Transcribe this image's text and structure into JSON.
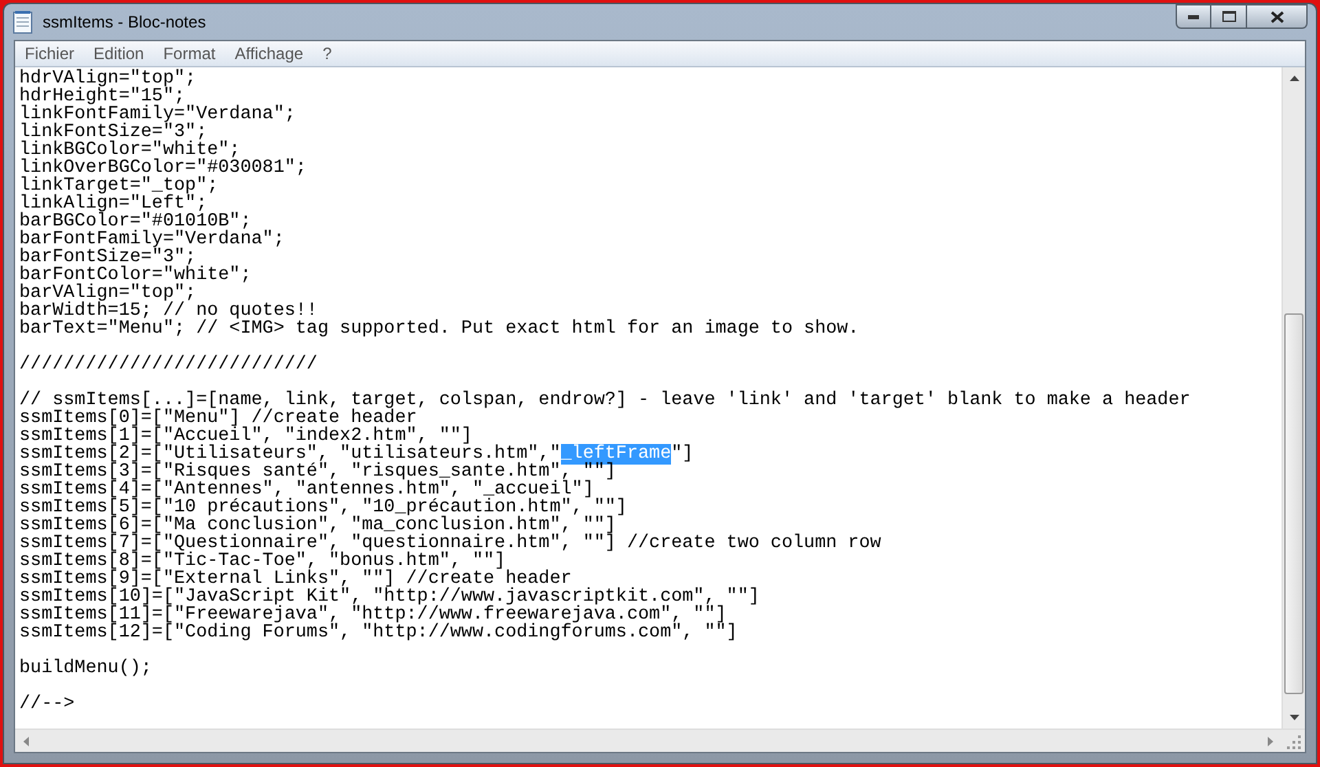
{
  "window": {
    "title": "ssmItems - Bloc-notes"
  },
  "menu": [
    "Fichier",
    "Edition",
    "Format",
    "Affichage",
    "?"
  ],
  "lines": [
    {
      "kind": "text",
      "text": "hdrVAlign=\"top\";"
    },
    {
      "kind": "text",
      "text": "hdrHeight=\"15\";"
    },
    {
      "kind": "text",
      "text": "linkFontFamily=\"Verdana\";"
    },
    {
      "kind": "text",
      "text": "linkFontSize=\"3\";"
    },
    {
      "kind": "text",
      "text": "linkBGColor=\"white\";"
    },
    {
      "kind": "text",
      "text": "linkOverBGColor=\"#030081\";"
    },
    {
      "kind": "text",
      "text": "linkTarget=\"_top\";"
    },
    {
      "kind": "text",
      "text": "linkAlign=\"Left\";"
    },
    {
      "kind": "text",
      "text": "barBGColor=\"#01010B\";"
    },
    {
      "kind": "text",
      "text": "barFontFamily=\"Verdana\";"
    },
    {
      "kind": "text",
      "text": "barFontSize=\"3\";"
    },
    {
      "kind": "text",
      "text": "barFontColor=\"white\";"
    },
    {
      "kind": "text",
      "text": "barVAlign=\"top\";"
    },
    {
      "kind": "text",
      "text": "barWidth=15; // no quotes!!"
    },
    {
      "kind": "text",
      "text": "barText=\"Menu\"; // <IMG> tag supported. Put exact html for an image to show."
    },
    {
      "kind": "blank"
    },
    {
      "kind": "text",
      "text": "///////////////////////////"
    },
    {
      "kind": "blank"
    },
    {
      "kind": "text",
      "text": "// ssmItems[...]=[name, link, target, colspan, endrow?] - leave 'link' and 'target' blank to make a header"
    },
    {
      "kind": "text",
      "text": "ssmItems[0]=[\"Menu\"] //create header"
    },
    {
      "kind": "text",
      "text": "ssmItems[1]=[\"Accueil\", \"index2.htm\", \"\"]"
    },
    {
      "kind": "segments",
      "segments": [
        {
          "text": "ssmItems[2]=[\"Utilisateurs\", \"utilisateurs.htm\",\"",
          "selected": false
        },
        {
          "text": "_leftFrame",
          "selected": true
        },
        {
          "text": "\"]",
          "selected": false
        }
      ]
    },
    {
      "kind": "text",
      "text": "ssmItems[3]=[\"Risques santé\", \"risques_sante.htm\", \"\"]"
    },
    {
      "kind": "text",
      "text": "ssmItems[4]=[\"Antennes\", \"antennes.htm\", \"_accueil\"]"
    },
    {
      "kind": "text",
      "text": "ssmItems[5]=[\"10 précautions\", \"10_précaution.htm\", \"\"]"
    },
    {
      "kind": "text",
      "text": "ssmItems[6]=[\"Ma conclusion\", \"ma_conclusion.htm\", \"\"]"
    },
    {
      "kind": "text",
      "text": "ssmItems[7]=[\"Questionnaire\", \"questionnaire.htm\", \"\"] //create two column row"
    },
    {
      "kind": "text",
      "text": "ssmItems[8]=[\"Tic-Tac-Toe\", \"bonus.htm\", \"\"]"
    },
    {
      "kind": "text",
      "text": "ssmItems[9]=[\"External Links\", \"\"] //create header"
    },
    {
      "kind": "text",
      "text": "ssmItems[10]=[\"JavaScript Kit\", \"http://www.javascriptkit.com\", \"\"]"
    },
    {
      "kind": "text",
      "text": "ssmItems[11]=[\"Freewarejava\", \"http://www.freewarejava.com\", \"\"]"
    },
    {
      "kind": "text",
      "text": "ssmItems[12]=[\"Coding Forums\", \"http://www.codingforums.com\", \"\"]"
    },
    {
      "kind": "blank"
    },
    {
      "kind": "text",
      "text": "buildMenu();"
    },
    {
      "kind": "blank"
    },
    {
      "kind": "text",
      "text": "//-->"
    }
  ]
}
